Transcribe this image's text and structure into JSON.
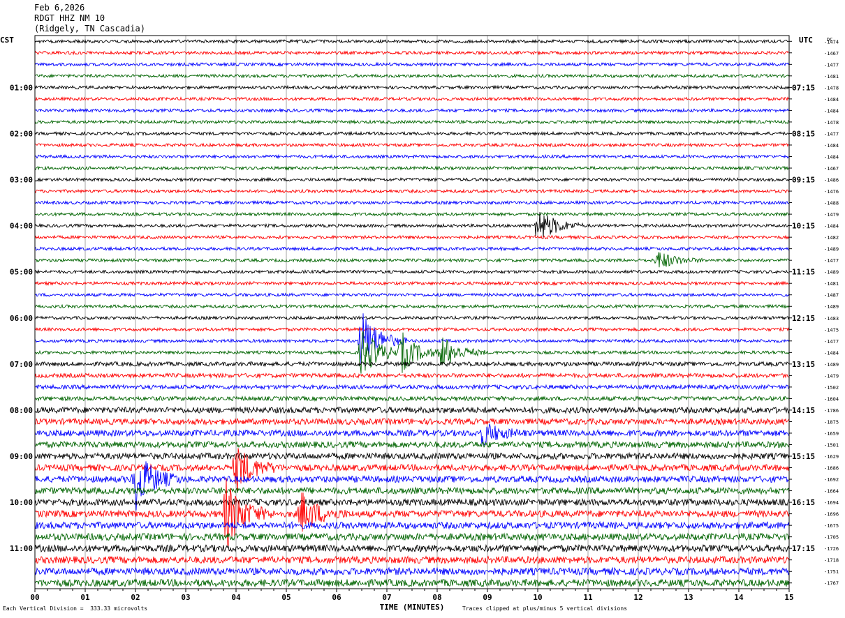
{
  "header": {
    "date": "Feb 6,2026",
    "station": "RDGT HHZ NM 10",
    "location": "(Ridgely, TN Cascadia)"
  },
  "chart_data": {
    "type": "line",
    "title": "Feb 6,2026",
    "xlabel": "TIME (MINUTES)",
    "left_axis_label": "CST",
    "right_axis_label": "UTC",
    "dc_label": "DC",
    "xlim": [
      0,
      15
    ],
    "x_ticks": [
      "00",
      "01",
      "02",
      "03",
      "04",
      "05",
      "06",
      "07",
      "08",
      "09",
      "10",
      "11",
      "12",
      "13",
      "14",
      "15"
    ],
    "left_hour_labels": [
      "01:00",
      "02:00",
      "03:00",
      "04:00",
      "05:00",
      "06:00",
      "07:00",
      "08:00",
      "09:00",
      "10:00",
      "11:00"
    ],
    "right_hour_labels": [
      "07:15",
      "08:15",
      "09:15",
      "10:15",
      "11:15",
      "12:15",
      "13:15",
      "14:15",
      "15:15",
      "16:15",
      "17:15"
    ],
    "dc_offsets": [
      -1474,
      -1467,
      -1477,
      -1481,
      -1478,
      -1484,
      -1484,
      -1478,
      -1477,
      -1484,
      -1484,
      -1467,
      -1486,
      -1476,
      -1488,
      -1479,
      -1484,
      -1482,
      -1489,
      -1477,
      -1489,
      -1481,
      -1487,
      -1489,
      -1483,
      -1475,
      -1477,
      -1484,
      -1489,
      -1479,
      -1502,
      -1604,
      -1786,
      -1875,
      -1659,
      -1501,
      -1629,
      -1686,
      -1692,
      -1664,
      -1694,
      -1696,
      -1675,
      -1705,
      -1726,
      -1718,
      -1751,
      -1767
    ],
    "trace_colors": [
      "#000000",
      "#ff0000",
      "#0000ff",
      "#006400"
    ],
    "grid": true,
    "events": [
      {
        "trace": 16,
        "minute": 10.0,
        "amplitude": 1.6
      },
      {
        "trace": 19,
        "minute": 12.4,
        "amplitude": 0.8
      },
      {
        "trace": 26,
        "minute": 6.5,
        "amplitude": 2.6
      },
      {
        "trace": 27,
        "minute": 6.5,
        "amplitude": 2.2
      },
      {
        "trace": 27,
        "minute": 7.3,
        "amplitude": 1.6
      },
      {
        "trace": 27,
        "minute": 8.1,
        "amplitude": 1.4
      },
      {
        "trace": 34,
        "minute": 8.9,
        "amplitude": 1.0
      },
      {
        "trace": 37,
        "minute": 4.0,
        "amplitude": 2.0
      },
      {
        "trace": 38,
        "minute": 2.0,
        "amplitude": 2.6
      },
      {
        "trace": 41,
        "minute": 3.8,
        "amplitude": 3.0
      },
      {
        "trace": 41,
        "minute": 5.3,
        "amplitude": 1.8
      }
    ]
  },
  "footer": {
    "scale_note": "Each Vertical Division =  333.33 microvolts",
    "clip_note": "Traces clipped at plus/minus 5 vertical divisions"
  }
}
